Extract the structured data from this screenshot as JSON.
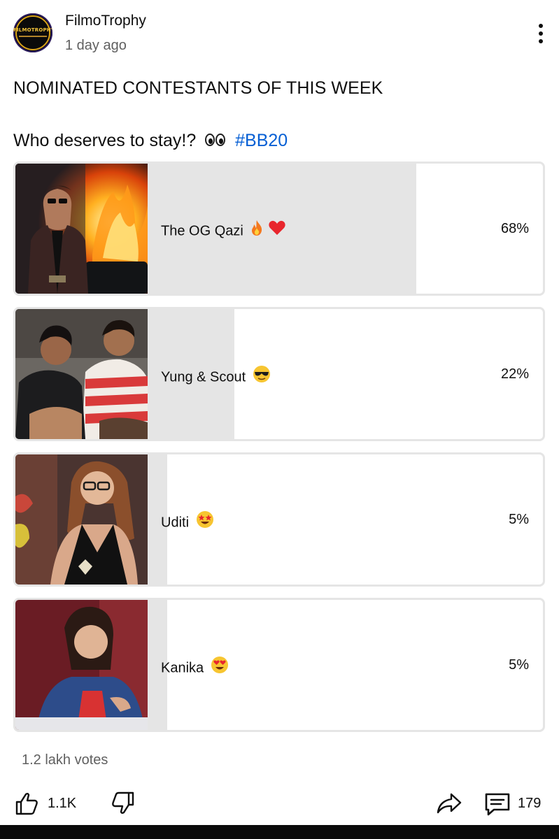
{
  "post": {
    "channel_name": "FilmoTrophy",
    "avatar_text": "FILMOTROPHY",
    "time": "1 day ago",
    "title": "NOMINATED CONTESTANTS OF THIS WEEK",
    "question": "Who deserves to stay!?",
    "hashtag": "#BB20"
  },
  "poll": {
    "options": [
      {
        "label": "The OG Qazi",
        "percent_label": "68%",
        "percent": 68,
        "emoji": [
          "fire-icon",
          "red-heart-icon"
        ]
      },
      {
        "label": "Yung & Scout",
        "percent_label": "22%",
        "percent": 22,
        "emoji": [
          "sunglasses-face-icon"
        ]
      },
      {
        "label": "Uditi",
        "percent_label": "5%",
        "percent": 5,
        "emoji": [
          "star-struck-face-icon"
        ]
      },
      {
        "label": "Kanika",
        "percent_label": "5%",
        "percent": 5,
        "emoji": [
          "heart-eyes-face-icon"
        ]
      }
    ],
    "votes": "1.2 lakh votes"
  },
  "actions": {
    "like_count": "1.1K",
    "comment_count": "179"
  },
  "colors": {
    "hashtag": "#065fd4",
    "poll_fill": "#e5e5e5",
    "poll_border": "#e5e5e5",
    "text_primary": "#0f0f0f",
    "text_secondary": "#606060"
  }
}
